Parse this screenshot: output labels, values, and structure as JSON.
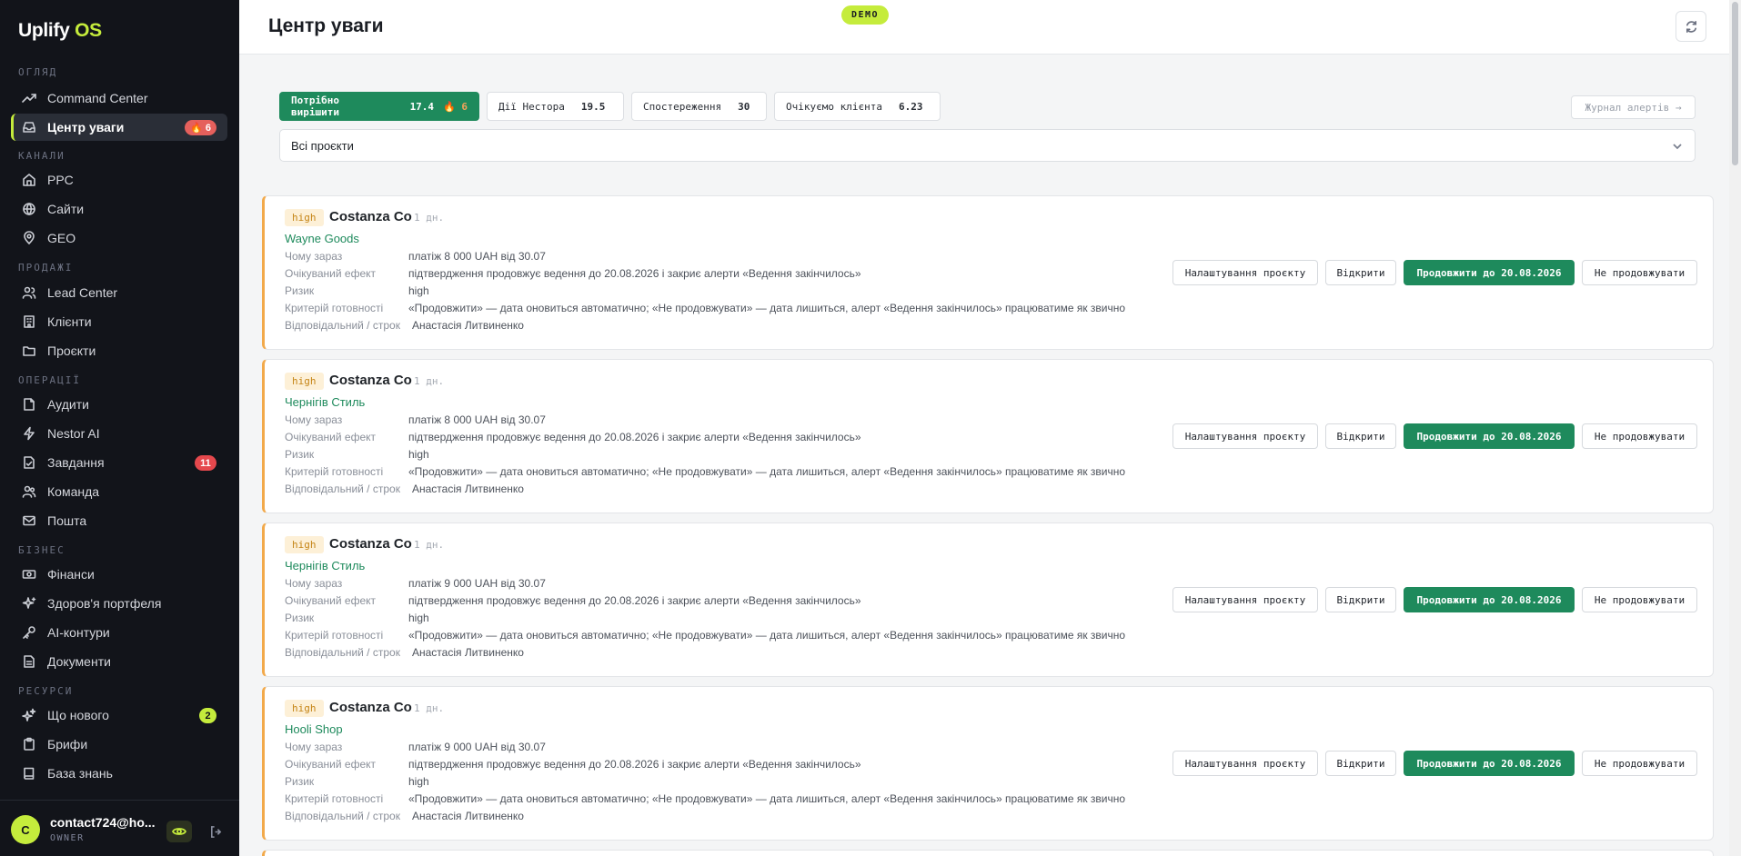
{
  "app": {
    "logo_main": "Uplify",
    "logo_accent": "OS",
    "brand_color": "#c5ec3c",
    "primary_color": "#1e8a5c"
  },
  "sidebar": {
    "sections": [
      "ОГЛЯД",
      "КАНАЛИ",
      "ПРОДАЖІ",
      "ОПЕРАЦІЇ",
      "БІЗНЕС",
      "РЕСУРСИ"
    ],
    "items": [
      {
        "label": "Command Center",
        "icon": "trending-up-icon"
      },
      {
        "label": "Центр уваги",
        "icon": "inbox-icon",
        "badge": "🔥 6",
        "active": true
      },
      {
        "label": "PPC",
        "icon": "home-icon"
      },
      {
        "label": "Сайти",
        "icon": "globe-icon"
      },
      {
        "label": "GEO",
        "icon": "map-pin-icon"
      },
      {
        "label": "Lead Center",
        "icon": "users-icon"
      },
      {
        "label": "Клієнти",
        "icon": "building-icon"
      },
      {
        "label": "Проєкти",
        "icon": "folder-icon"
      },
      {
        "label": "Аудити",
        "icon": "file-icon"
      },
      {
        "label": "Nestor AI",
        "icon": "zap-icon"
      },
      {
        "label": "Завдання",
        "icon": "file-check-icon",
        "badge": "11"
      },
      {
        "label": "Команда",
        "icon": "team-icon"
      },
      {
        "label": "Пошта",
        "icon": "mail-icon"
      },
      {
        "label": "Фінанси",
        "icon": "banknote-icon"
      },
      {
        "label": "Здоров'я портфеля",
        "icon": "sparkle-icon"
      },
      {
        "label": "AI-контури",
        "icon": "key-icon"
      },
      {
        "label": "Документи",
        "icon": "document-icon"
      },
      {
        "label": "Що нового",
        "icon": "stars-icon",
        "badge": "2"
      },
      {
        "label": "Брифи",
        "icon": "clipboard-icon"
      },
      {
        "label": "База знань",
        "icon": "book-icon"
      }
    ]
  },
  "user": {
    "avatar": "C",
    "email": "contact724@ho...",
    "role": "OWNER"
  },
  "header": {
    "title": "Центр уваги",
    "demo": "DEMO"
  },
  "filters": {
    "tabs": [
      {
        "label": "Потрібно вирішити",
        "value": "17.4",
        "extra": "🔥 6"
      },
      {
        "label": "Дії Нестора",
        "value": "19.5"
      },
      {
        "label": "Спостереження",
        "value": "30"
      },
      {
        "label": "Очікуємо клієнта",
        "value": "6.23"
      }
    ],
    "journal": "Журнал алертів →",
    "project_select": "Всі проєкти"
  },
  "labels": {
    "why": "Чому зараз",
    "effect": "Очікуваний ефект",
    "risk": "Ризик",
    "criteria": "Критерій готовності",
    "owner": "Відповідальний / строк"
  },
  "actions": {
    "settings": "Налаштування проєкту",
    "open": "Відкрити",
    "extend": "Продовжити до 20.08.2026",
    "decline": "Не продовжувати"
  },
  "alerts": [
    {
      "priority": "high",
      "client": "Costanza Co",
      "age": "1 дн.",
      "project": "Wayne Goods",
      "why": "платіж 8 000 UAH від 30.07",
      "effect": "підтвердження продовжує ведення до 20.08.2026 і закриє алерти «Ведення закінчилось»",
      "risk": "high",
      "criteria": "«Продовжити» — дата оновиться автоматично; «Не продовжувати» — дата лишиться, алерт «Ведення закінчилось» працюватиме як звично",
      "owner": "Анастасія Литвиненко"
    },
    {
      "priority": "high",
      "client": "Costanza Co",
      "age": "1 дн.",
      "project": "Чернігів Стиль",
      "why": "платіж 8 000 UAH від 30.07",
      "effect": "підтвердження продовжує ведення до 20.08.2026 і закриє алерти «Ведення закінчилось»",
      "risk": "high",
      "criteria": "«Продовжити» — дата оновиться автоматично; «Не продовжувати» — дата лишиться, алерт «Ведення закінчилось» працюватиме як звично",
      "owner": "Анастасія Литвиненко"
    },
    {
      "priority": "high",
      "client": "Costanza Co",
      "age": "1 дн.",
      "project": "Чернігів Стиль",
      "why": "платіж 9 000 UAH від 30.07",
      "effect": "підтвердження продовжує ведення до 20.08.2026 і закриє алерти «Ведення закінчилось»",
      "risk": "high",
      "criteria": "«Продовжити» — дата оновиться автоматично; «Не продовжувати» — дата лишиться, алерт «Ведення закінчилось» працюватиме як звично",
      "owner": "Анастасія Литвиненко"
    },
    {
      "priority": "high",
      "client": "Costanza Co",
      "age": "1 дн.",
      "project": "Hooli Shop",
      "why": "платіж 9 000 UAH від 30.07",
      "effect": "підтвердження продовжує ведення до 20.08.2026 і закриє алерти «Ведення закінчилось»",
      "risk": "high",
      "criteria": "«Продовжити» — дата оновиться автоматично; «Не продовжувати» — дата лишиться, алерт «Ведення закінчилось» працюватиме як звично",
      "owner": "Анастасія Литвиненко"
    }
  ]
}
